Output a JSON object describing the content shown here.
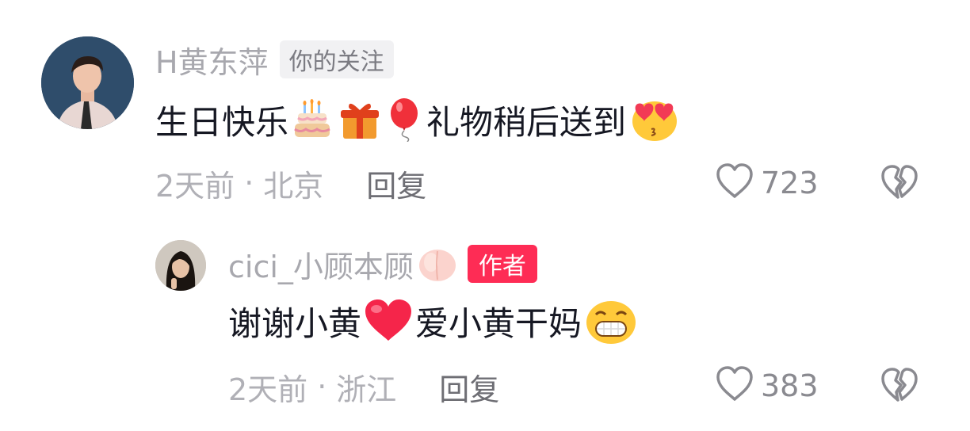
{
  "comments": [
    {
      "username": "H黄东萍",
      "badge": "你的关注",
      "text_main": "生日快乐",
      "text_after": "礼物稍后送到",
      "time": "2天前",
      "location": "北京",
      "reply_label": "回复",
      "likes": "723"
    },
    {
      "username": "cici_小顾本顾",
      "badge": "作者",
      "text_main": "谢谢小黄",
      "text_after": "爱小黄干妈",
      "time": "2天前",
      "location": "浙江",
      "reply_label": "回复",
      "likes": "383"
    }
  ],
  "meta_separator": "·",
  "icons": {
    "like": "heart-outline-icon",
    "dislike": "broken-heart-icon",
    "emojis_comment_1": [
      "birthday-cake-emoji",
      "gift-emoji",
      "balloon-emoji",
      "heart-eyes-emoji"
    ],
    "emojis_comment_2": [
      "red-heart-emoji",
      "grinning-emoji"
    ],
    "name_emoji_comment_2": "peach-emoji"
  },
  "colors": {
    "author_badge": "#fe2c55",
    "username": "#a8a8ae",
    "text": "#161823"
  }
}
